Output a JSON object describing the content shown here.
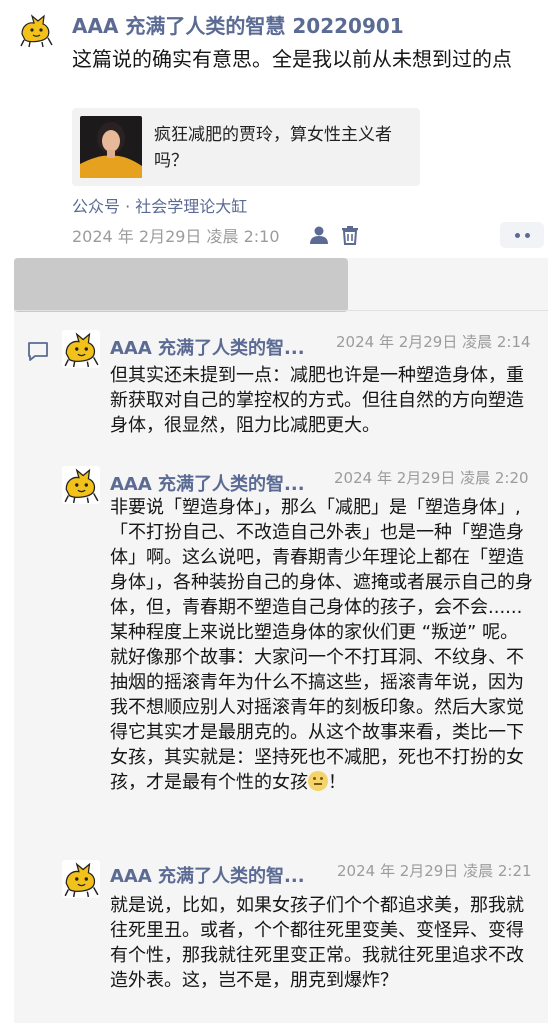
{
  "post": {
    "author": "AAA 充满了人类的智慧 20220901",
    "text": "这篇说的确实有意思。全是我以前从未想到过的点",
    "share_card": {
      "title": "疯狂减肥的贾玲，算女性主义者吗？"
    },
    "source": "公众号 · 社会学理论大缸",
    "time": "2024 年 2月29日 凌晨 2:10"
  },
  "comments": [
    {
      "author": "AAA 充满了人类的智...",
      "time": "2024 年 2月29日 凌晨 2:14",
      "text": "但其实还未提到一点：减肥也许是一种塑造身体，重新获取对自己的掌控权的方式。但往自然的方向塑造身体，很显然，阻力比减肥更大。"
    },
    {
      "author": "AAA 充满了人类的智...",
      "time": "2024 年 2月29日 凌晨 2:20",
      "text": "非要说「塑造身体」，那么「减肥」是「塑造身体」,「不打扮自己、不改造自己外表」也是一种「塑造身体」啊。这么说吧，青春期青少年理论上都在「塑造身体」，各种装扮自己的身体、遮掩或者展示自己的身体，但，青春期不塑造自己身体的孩子，会不会......某种程度上来说比塑造身体的家伙们更 “叛逆” 呢。就好像那个故事：大家问一个不打耳洞、不纹身、不抽烟的摇滚青年为什么不搞这些，摇滚青年说，因为我不想顺应别人对摇滚青年的刻板印象。然后大家觉得它其实才是最朋克的。从这个故事来看，类比一下女孩，其实就是：坚持死也不减肥，死也不打扮的女孩，才是最有个性的女孩",
      "text_end": "！"
    },
    {
      "author": "AAA 充满了人类的智...",
      "time": "2024 年 2月29日 凌晨 2:21",
      "text": "就是说，比如，如果女孩子们个个都追求美，那我就往死里丑。或者，个个都往死里变美、变怪异、变得有个性，那我就往死里变正常。我就往死里追求不改造外表。这，岂不是，朋克到爆炸？"
    }
  ],
  "icons": {
    "avatar": "yellow-cat-icon",
    "visibility": "person-icon",
    "delete": "trash-icon",
    "more": "more-dots-icon",
    "comment": "comment-icon",
    "emoji": "neutral-face-emoji-icon"
  },
  "colors": {
    "name": "#5b6b93",
    "time": "#9c9c9c",
    "comment_bg": "#f5f5f5"
  }
}
